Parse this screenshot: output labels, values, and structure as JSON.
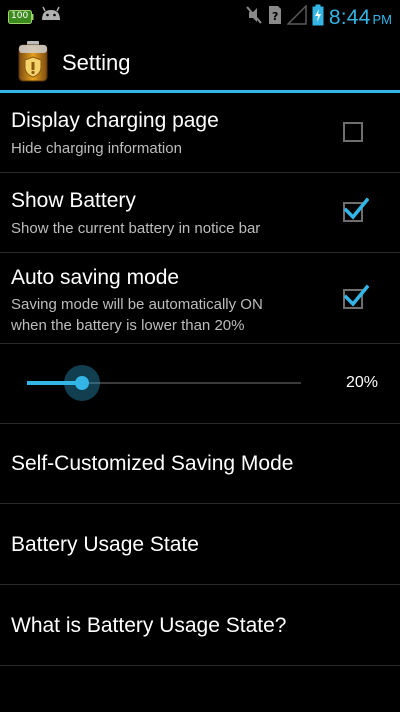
{
  "status_bar": {
    "battery_level_text": "100",
    "time": "8:44",
    "ampm": "PM",
    "accent_color": "#33b5e5",
    "icons": [
      "battery-small-icon",
      "android-icon",
      "mute-icon",
      "sim-unknown-icon",
      "signal-icon",
      "battery-charging-icon"
    ]
  },
  "action_bar": {
    "title": "Setting",
    "icon": "battery-shield-icon"
  },
  "settings": {
    "display_charging": {
      "title": "Display charging page",
      "summary": "Hide charging information",
      "checked": false
    },
    "show_battery": {
      "title": "Show Battery",
      "summary": "Show the current battery in notice bar",
      "checked": true
    },
    "auto_saving": {
      "title": "Auto saving mode",
      "summary_line1": "Saving mode will be automatically ON",
      "summary_line2": "when the battery is lower than 20%",
      "checked": true
    },
    "threshold_slider": {
      "value_percent": 20,
      "label": "20%"
    },
    "self_customized": {
      "title": "Self-Customized Saving Mode"
    },
    "usage_state": {
      "title": "Battery Usage State"
    },
    "what_is_usage": {
      "title": "What is Battery Usage State?"
    }
  }
}
